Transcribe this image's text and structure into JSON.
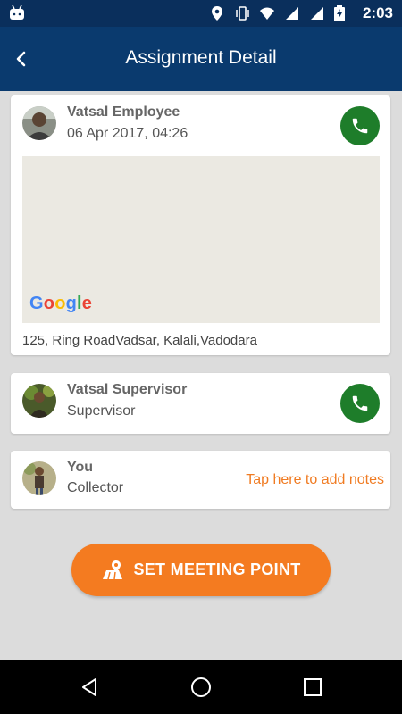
{
  "status_bar": {
    "time": "2:03",
    "icons": [
      "android-icon",
      "location-icon",
      "vibrate-icon",
      "wifi-icon",
      "signal-icon",
      "signal-icon",
      "battery-charging-icon"
    ]
  },
  "header": {
    "title": "Assignment Detail",
    "back_icon": "chevron-left-icon"
  },
  "employee": {
    "name": "Vatsal Employee",
    "datetime": "06 Apr 2017, 04:26",
    "map_logo": "Google",
    "address": "125, Ring RoadVadsar, Kalali,Vadodara",
    "call_icon": "phone-icon"
  },
  "supervisor": {
    "name": "Vatsal Supervisor",
    "role": "Supervisor",
    "call_icon": "phone-icon"
  },
  "you": {
    "name": "You",
    "role": "Collector",
    "notes_link": "Tap here to add notes"
  },
  "meeting_button": {
    "label": "SET MEETING POINT",
    "icon": "map-pin-icon"
  },
  "nav": {
    "icons": [
      "back-triangle-icon",
      "home-circle-icon",
      "recents-square-icon"
    ]
  },
  "colors": {
    "header": "#0a3a6e",
    "status_bar": "#0a2f5c",
    "call_green": "#1e7d2a",
    "accent_orange": "#f47b20",
    "background": "#dcdcdc"
  }
}
